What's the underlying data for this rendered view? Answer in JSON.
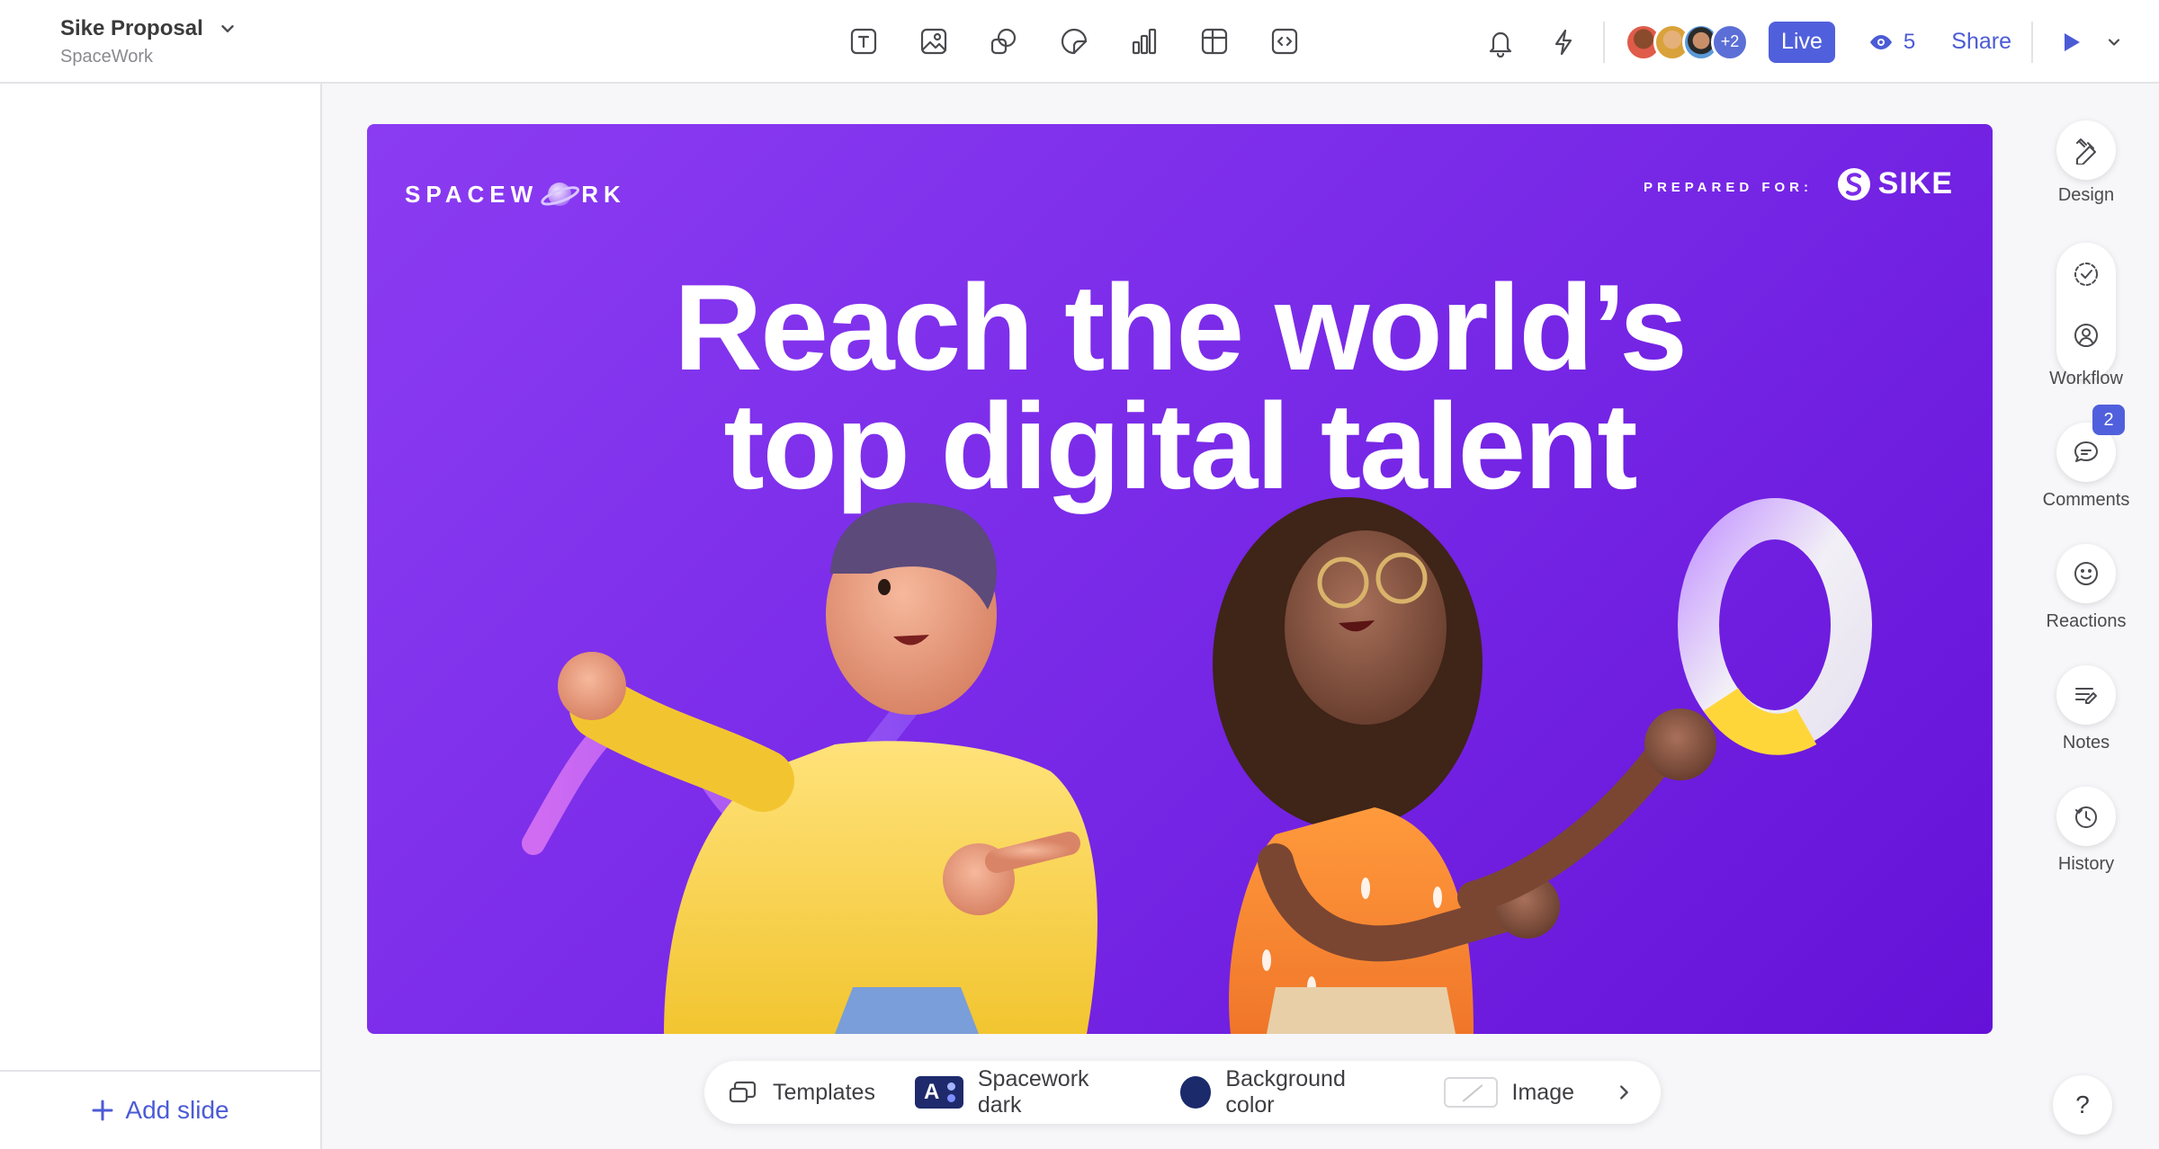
{
  "document": {
    "title": "Sike Proposal",
    "workspace": "SpaceWork"
  },
  "toolbar": {
    "tools": [
      "text-icon",
      "image-icon",
      "shapes-icon",
      "sticker-icon",
      "chart-icon",
      "table-icon",
      "embed-icon"
    ]
  },
  "header_right": {
    "collaborators_more": "+2",
    "live_label": "Live",
    "viewers_count": "5",
    "share_label": "Share"
  },
  "left_panel": {
    "add_slide_label": "Add slide"
  },
  "slide": {
    "brand_prefix": "SPACEW",
    "brand_suffix": "RK",
    "prepared_for_label": "PREPARED FOR:",
    "client_logo": "SIKE",
    "headline_line1": "Reach the world’s",
    "headline_line2": "top digital talent"
  },
  "right_rail": {
    "design_label": "Design",
    "workflow_label": "Workflow",
    "comments_label": "Comments",
    "comments_badge": "2",
    "reactions_label": "Reactions",
    "notes_label": "Notes",
    "history_label": "History"
  },
  "bottom_bar": {
    "templates_label": "Templates",
    "theme_label": "Spacework dark",
    "theme_chip_letter": "A",
    "background_label": "Background color",
    "image_label": "Image"
  },
  "help_label": "?",
  "colors": {
    "accent": "#5060dc",
    "slide_purple": "#7a2be8",
    "background_swatch": "#1b2a6b"
  }
}
